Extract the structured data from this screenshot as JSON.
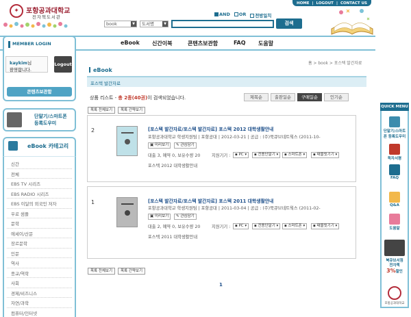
{
  "top_links": [
    "HOME",
    "LOGOUT",
    "CONTACT US"
  ],
  "header": {
    "title": "포항공과대학교",
    "subtitle": "전자책도서관",
    "search": {
      "options": [
        {
          "label": "AND",
          "checked": true
        },
        {
          "label": "OR",
          "checked": false
        },
        {
          "label": "전방일치",
          "checked": false
        }
      ],
      "category_select": "book",
      "field_select": "도서명",
      "query": "",
      "button": "검색"
    }
  },
  "member_login_label": "MEMBER LOGIN",
  "main_nav": [
    "eBook",
    "신간이북",
    "콘텐츠보관함",
    "FAQ",
    "도움말"
  ],
  "login": {
    "username": "kaykim",
    "suffix": "님",
    "welcome": "환영합니다.",
    "logout": "Logout",
    "content_locker": "콘텐츠보관함"
  },
  "reader_promo": {
    "line1": "단말기/스마트폰",
    "line2": "등록도우미"
  },
  "category": {
    "title": "eBook 카테고리",
    "items": [
      "신간",
      "전체",
      "EBS TV 시리즈",
      "EBS RADIO 시리즈",
      "EBS 이달의 외국인 저자",
      "우로 샘플",
      "문학",
      "에세이/산문",
      "장르문학",
      "인문",
      "역사",
      "종교/역학",
      "사회",
      "경제/비즈니스",
      "자연/과학",
      "컴퓨터/인터넷"
    ]
  },
  "breadcrumb": "홈 > book > 포스텍 발간자료",
  "page_title": "eBook",
  "section_title": "포스텍 발간자료",
  "results": {
    "prefix": "상품 리스트 - ",
    "count": "총 2종(40권)",
    "suffix": "이 검색되었습니다."
  },
  "sort_buttons": [
    {
      "label": "제목순",
      "active": false
    },
    {
      "label": "출판일순",
      "active": false
    },
    {
      "label": "구매일순",
      "active": true
    },
    {
      "label": "인기순",
      "active": false
    }
  ],
  "list_buttons": {
    "expand": "목록 전체보기",
    "collapse": "목록 간략보기"
  },
  "items": [
    {
      "num": "2",
      "cover_color": "#bfe1e8",
      "category": "[포스텍 발간자료/포스텍 발간자료]",
      "title": "포스텍 2012 대학생활안내",
      "meta": "포항공과대학교 학생지원팀 | 포항공대 | 2012-03-21 | 공급 : (주)북큐브네트웍스 (2011-10-",
      "preview": "미리보기",
      "wishlist": "관심담기",
      "stock": "대출 3, 예약 0, 보유수량 20",
      "devices_label": "지원기기 :",
      "devices": [
        "PC",
        "전용단말기",
        "스마트폰",
        "태블릿기기"
      ],
      "description": "포스텍 2012 대학생활안내"
    },
    {
      "num": "1",
      "cover_color": "#b9b9b9",
      "category": "[포스텍 발간자료/포스텍 발간자료]",
      "title": "포스텍 2011 대학생활안내",
      "meta": "포항공과대학교 학생지원팀 | 포항공대 | 2011-03-04 | 공급 : (주)북큐브네트웍스 (2011-02-",
      "preview": "미리보기",
      "wishlist": "관심담기",
      "stock": "대출 2, 예약 0, 보유수량 20",
      "devices_label": "지원기기 :",
      "devices": [
        "PC",
        "전용단말기",
        "스마트폰",
        "태블릿기기"
      ],
      "description": "포스텍 2011 대학생활안내"
    }
  ],
  "pagination": "1",
  "quick_menu": {
    "title": "QUICK MENU",
    "items": [
      "단말기/스마트폰 등록도우미",
      "독자서평",
      "FAQ",
      "Q&A",
      "도움말"
    ],
    "sale_line1": "북큐브서점",
    "sale_line2": "전자책",
    "sale_pct": "3%",
    "sale_suffix": "할인",
    "footer": "포항공과대학교"
  }
}
